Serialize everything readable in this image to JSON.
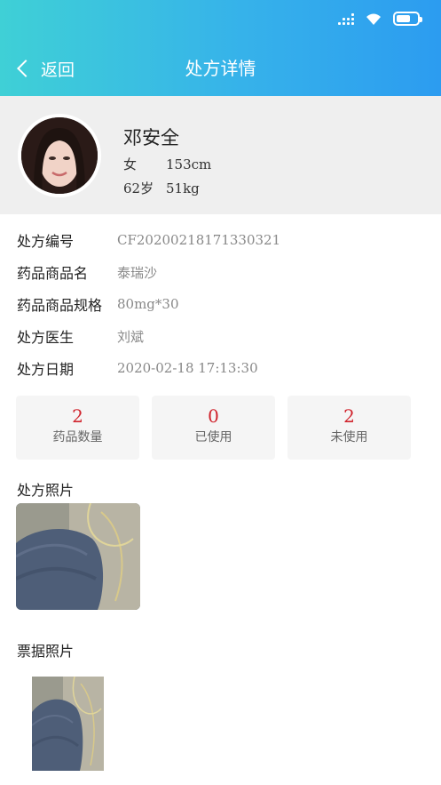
{
  "nav": {
    "back_label": "返回",
    "title": "处方详情"
  },
  "status_bar": {
    "icons": [
      "signal-icon",
      "wifi-icon",
      "battery-icon"
    ]
  },
  "patient": {
    "name": "邓安全",
    "gender": "女",
    "height": "153cm",
    "age": "62岁",
    "weight": "51kg"
  },
  "details": [
    {
      "label": "处方编号",
      "value": "CF20200218171330321"
    },
    {
      "label": "药品商品名",
      "value": "泰瑞沙"
    },
    {
      "label": "药品商品规格",
      "value": "80mg*30"
    },
    {
      "label": "处方医生",
      "value": "刘斌"
    },
    {
      "label": "处方日期",
      "value": "2020-02-18 17:13:30"
    }
  ],
  "stats": [
    {
      "value": "2",
      "label": "药品数量"
    },
    {
      "value": "0",
      "label": "已使用"
    },
    {
      "value": "2",
      "label": "未使用"
    }
  ],
  "sections": {
    "prescription_photo": "处方照片",
    "receipt_photo": "票据照片"
  },
  "colors": {
    "header_start": "#3fd0d6",
    "header_end": "#2c9cf0",
    "stat_number": "#d0232c",
    "profile_bg": "#efefef"
  }
}
